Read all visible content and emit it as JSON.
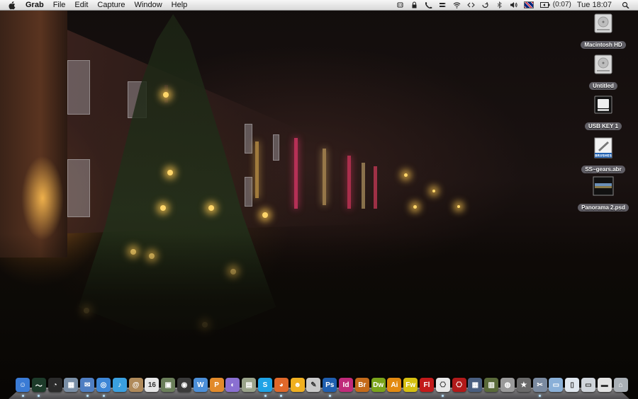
{
  "menubar": {
    "app_name": "Grab",
    "menus": [
      "File",
      "Edit",
      "Capture",
      "Window",
      "Help"
    ],
    "battery_time": "(0:07)",
    "clock": "Tue 18:07"
  },
  "desktop_icons": [
    {
      "label": "Macintosh HD",
      "icon": "hard-drive-icon"
    },
    {
      "label": "Untitled",
      "icon": "hard-drive-icon"
    },
    {
      "label": "USB KEY 1",
      "icon": "usb-drive-icon"
    },
    {
      "label": "SS~gears.abr",
      "icon": "brushes-file-icon",
      "badge": "BRUSHES"
    },
    {
      "label": "Panorama 2.psd",
      "icon": "image-file-icon"
    }
  ],
  "dock": {
    "apps": [
      {
        "name": "finder",
        "glyph": "☺",
        "color": "#3a7bd5"
      },
      {
        "name": "activity-monitor",
        "glyph": "〜",
        "color": "#1d3b2a"
      },
      {
        "name": "dashboard",
        "glyph": "◔",
        "color": "#2b2b2b"
      },
      {
        "name": "preview",
        "glyph": "▦",
        "color": "#7a8fa6"
      },
      {
        "name": "mail",
        "glyph": "✉",
        "color": "#4f7ec2"
      },
      {
        "name": "safari",
        "glyph": "◎",
        "color": "#3d86d6"
      },
      {
        "name": "itunes",
        "glyph": "♪",
        "color": "#3aa0e0"
      },
      {
        "name": "address-book",
        "glyph": "@",
        "color": "#b08a5a"
      },
      {
        "name": "ical",
        "glyph": "16",
        "color": "#e6e6e6"
      },
      {
        "name": "iphoto",
        "glyph": "▣",
        "color": "#6b7f5a"
      },
      {
        "name": "photo-booth",
        "glyph": "◉",
        "color": "#3a3a3a"
      },
      {
        "name": "iweb",
        "glyph": "W",
        "color": "#4c8fd8"
      },
      {
        "name": "pages",
        "glyph": "P",
        "color": "#e28a2a"
      },
      {
        "name": "skype-alt",
        "glyph": "◐",
        "color": "#8a6fd1"
      },
      {
        "name": "installer",
        "glyph": "▤",
        "color": "#9aa38a"
      },
      {
        "name": "skype",
        "glyph": "S",
        "color": "#1fa3e6"
      },
      {
        "name": "firefox",
        "glyph": "◕",
        "color": "#e0682a"
      },
      {
        "name": "adium",
        "glyph": "☻",
        "color": "#f0b020"
      },
      {
        "name": "textedit",
        "glyph": "✎",
        "color": "#c9c9c9"
      },
      {
        "name": "photoshop",
        "glyph": "Ps",
        "color": "#1f5fb0"
      },
      {
        "name": "indesign",
        "glyph": "Id",
        "color": "#c02a7a"
      },
      {
        "name": "bridge",
        "glyph": "Br",
        "color": "#c46a1a"
      },
      {
        "name": "dreamweaver",
        "glyph": "Dw",
        "color": "#7aa41a"
      },
      {
        "name": "illustrator",
        "glyph": "Ai",
        "color": "#e38a10"
      },
      {
        "name": "fireworks",
        "glyph": "Fw",
        "color": "#d6c010"
      },
      {
        "name": "flash",
        "glyph": "Fl",
        "color": "#c21a1a"
      },
      {
        "name": "acrobat-reader",
        "glyph": "⎔",
        "color": "#e8e8e8"
      },
      {
        "name": "acrobat",
        "glyph": "⎔",
        "color": "#b11a1a"
      },
      {
        "name": "expose",
        "glyph": "▦",
        "color": "#4a5f80"
      },
      {
        "name": "istat",
        "glyph": "▥",
        "color": "#5a6a3a"
      },
      {
        "name": "network-utility",
        "glyph": "◍",
        "color": "#9a9a9a"
      },
      {
        "name": "capture-app",
        "glyph": "★",
        "color": "#6a6a6a"
      },
      {
        "name": "grab",
        "glyph": "✂",
        "color": "#7a8aa0"
      },
      {
        "name": "applications-folder",
        "glyph": "▭",
        "color": "#8ab0d8"
      },
      {
        "name": "documents-stack",
        "glyph": "▯",
        "color": "#dfe6ee"
      },
      {
        "name": "downloads-stack",
        "glyph": "▭",
        "color": "#cfd4da"
      },
      {
        "name": "minimized-window",
        "glyph": "▬",
        "color": "#e3e3e3"
      },
      {
        "name": "trash",
        "glyph": "⌂",
        "color": "#aab0b6"
      }
    ]
  }
}
